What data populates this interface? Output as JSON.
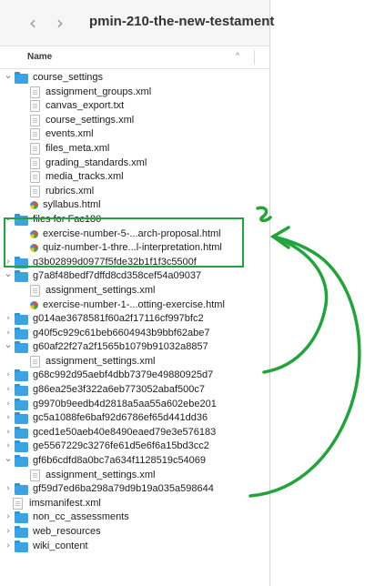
{
  "toolbar": {
    "back": "‹",
    "forward": "›",
    "title": "pmin-210-the-new-testament"
  },
  "column": {
    "name": "Name",
    "sort": "^"
  },
  "rows": [
    {
      "label": "course_settings",
      "type": "folder",
      "indent": 0,
      "chevron": "down"
    },
    {
      "label": "assignment_groups.xml",
      "type": "doc",
      "indent": 1,
      "chevron": ""
    },
    {
      "label": "canvas_export.txt",
      "type": "doc",
      "indent": 1,
      "chevron": ""
    },
    {
      "label": "course_settings.xml",
      "type": "doc",
      "indent": 1,
      "chevron": ""
    },
    {
      "label": "events.xml",
      "type": "doc",
      "indent": 1,
      "chevron": ""
    },
    {
      "label": "files_meta.xml",
      "type": "doc",
      "indent": 1,
      "chevron": ""
    },
    {
      "label": "grading_standards.xml",
      "type": "doc",
      "indent": 1,
      "chevron": ""
    },
    {
      "label": "media_tracks.xml",
      "type": "doc",
      "indent": 1,
      "chevron": ""
    },
    {
      "label": "rubrics.xml",
      "type": "doc",
      "indent": 1,
      "chevron": ""
    },
    {
      "label": "syllabus.html",
      "type": "html",
      "indent": 1,
      "chevron": ""
    },
    {
      "label": "files for Fac180",
      "type": "folder",
      "indent": 0,
      "chevron": "down"
    },
    {
      "label": "exercise-number-5-...arch-proposal.html",
      "type": "html",
      "indent": 1,
      "chevron": ""
    },
    {
      "label": "quiz-number-1-thre...l-interpretation.html",
      "type": "html",
      "indent": 1,
      "chevron": ""
    },
    {
      "label": "g3b02899d0977f5fde32b1f1f3c5500f",
      "type": "folder",
      "indent": 0,
      "chevron": "right"
    },
    {
      "label": "g7a8f48bedf7dffd8cd358cef54a09037",
      "type": "folder",
      "indent": 0,
      "chevron": "down"
    },
    {
      "label": "assignment_settings.xml",
      "type": "doc",
      "indent": 1,
      "chevron": ""
    },
    {
      "label": "exercise-number-1-...otting-exercise.html",
      "type": "html",
      "indent": 1,
      "chevron": ""
    },
    {
      "label": "g014ae3678581f60a2f17116cf997bfc2",
      "type": "folder",
      "indent": 0,
      "chevron": "right"
    },
    {
      "label": "g40f5c929c61beb6604943b9bbf62abe7",
      "type": "folder",
      "indent": 0,
      "chevron": "right"
    },
    {
      "label": "g60af22f27a2f1565b1079b91032a8857",
      "type": "folder",
      "indent": 0,
      "chevron": "down"
    },
    {
      "label": "assignment_settings.xml",
      "type": "doc",
      "indent": 1,
      "chevron": ""
    },
    {
      "label": "g68c992d95aebf4dbb7379e49880925d7",
      "type": "folder",
      "indent": 0,
      "chevron": "right"
    },
    {
      "label": "g86ea25e3f322a6eb773052abaf500c7",
      "type": "folder",
      "indent": 0,
      "chevron": "right"
    },
    {
      "label": "g9970b9eedb4d2818a5aa55a602ebe201",
      "type": "folder",
      "indent": 0,
      "chevron": "right"
    },
    {
      "label": "gc5a1088fe6baf92d6786ef65d441dd36",
      "type": "folder",
      "indent": 0,
      "chevron": "right"
    },
    {
      "label": "gced1e50aeb40e8490eaed79e3e576183",
      "type": "folder",
      "indent": 0,
      "chevron": "right"
    },
    {
      "label": "ge5567229c3276fe61d5e6f6a15bd3cc2",
      "type": "folder",
      "indent": 0,
      "chevron": "right"
    },
    {
      "label": "gf6b6cdfd8a0bc7a634f1128519c54069",
      "type": "folder",
      "indent": 0,
      "chevron": "down"
    },
    {
      "label": "assignment_settings.xml",
      "type": "doc",
      "indent": 1,
      "chevron": ""
    },
    {
      "label": "gf59d7ed6ba298a79d9b19a035a598644",
      "type": "folder",
      "indent": 0,
      "chevron": "right"
    },
    {
      "label": "imsmanifest.xml",
      "type": "doc",
      "indent": 0,
      "chevron": ""
    },
    {
      "label": "non_cc_assessments",
      "type": "folder",
      "indent": 0,
      "chevron": "right"
    },
    {
      "label": "web_resources",
      "type": "folder",
      "indent": 0,
      "chevron": "right"
    },
    {
      "label": "wiki_content",
      "type": "folder",
      "indent": 0,
      "chevron": "right"
    }
  ],
  "colors": {
    "annotation": "#21a53a",
    "folder": "#3aa3e3"
  },
  "icons": {
    "folder": "folder-icon",
    "doc": "document-icon",
    "html": "html-file-icon"
  }
}
